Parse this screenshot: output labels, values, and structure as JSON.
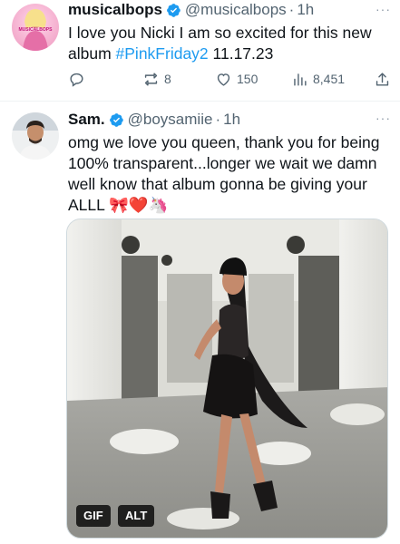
{
  "tweets": [
    {
      "avatar_caption": "MUSICALBOPS",
      "name": "musicalbops",
      "handle": "@musicalbops",
      "separator": "·",
      "time": "1h",
      "text_before": "I love you Nicki I am so excited for this new album ",
      "hashtag": "#PinkFriday2",
      "text_after": " 11.17.23",
      "more": "···",
      "actions": {
        "reply": "",
        "retweet": "8",
        "like": "150",
        "views": "8,451"
      }
    },
    {
      "name": "Sam.",
      "handle": "@boysamiie",
      "separator": "·",
      "time": "1h",
      "text": "omg we love you queen, thank you for being 100% transparent...longer we wait we damn well know that album gonna be giving your ALLL 🎀❤️🦄",
      "more": "···",
      "media": {
        "gif_label": "GIF",
        "alt_label": "ALT"
      }
    }
  ],
  "colors": {
    "accent": "#1d9bf0",
    "muted": "#536471",
    "text": "#0f1419"
  }
}
